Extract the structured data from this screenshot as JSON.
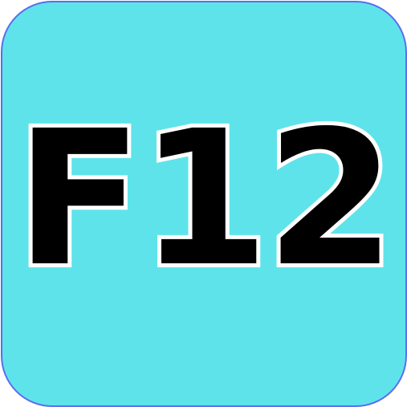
{
  "key": {
    "label": "F12",
    "icon": "f12-key-icon"
  },
  "colors": {
    "key_fill": "#5fe3ea",
    "key_border": "#5a6cf0",
    "label_fill": "#000000",
    "label_outline": "#ffffff"
  }
}
